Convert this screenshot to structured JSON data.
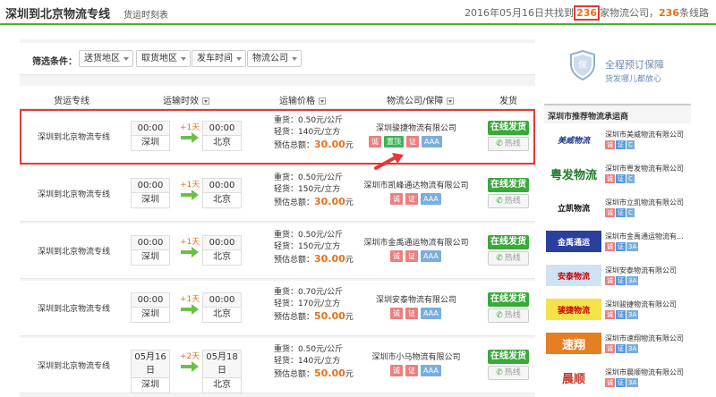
{
  "header": {
    "title": "深圳到北京物流专线",
    "subtitle": "货运时刻表",
    "stats_prefix": "2016年05月16日共找到",
    "company_count": "236",
    "stats_mid": "家物流公司，",
    "line_count": "236",
    "stats_suffix": "条线路"
  },
  "filter": {
    "label": "筛选条件：",
    "dropdowns": [
      "送货地区",
      "取货地区",
      "发车时间",
      "物流公司"
    ]
  },
  "table_headers": [
    "货运专线",
    "运输时效",
    "运输价格",
    "物流公司/保障",
    "发货"
  ],
  "rows": [
    {
      "route": "深圳到北京物流专线",
      "dep_time": "00:00",
      "dep_city": "深圳",
      "days": "+1天",
      "arr_time": "00:00",
      "arr_city": "北京",
      "heavy": "重货：0.50元/公斤",
      "light": "轻货：140元/立方",
      "total_label": "预估总额：",
      "total": "30.00",
      "total_unit": "元",
      "company": "深圳骏捷物流有限公司",
      "badges": [
        "诚",
        "置顶",
        "证",
        "AAA"
      ],
      "ship": "在线发货",
      "hotline": "热线"
    },
    {
      "route": "深圳到北京物流专线",
      "dep_time": "00:00",
      "dep_city": "深圳",
      "days": "+1天",
      "arr_time": "00:00",
      "arr_city": "北京",
      "heavy": "重货：0.50元/公斤",
      "light": "轻货：150元/立方",
      "total_label": "预估总额：",
      "total": "30.00",
      "total_unit": "元",
      "company": "深圳市凯峰通达物流有限公司",
      "badges": [
        "诚",
        "证",
        "AAA"
      ],
      "ship": "在线发货",
      "hotline": "热线"
    },
    {
      "route": "深圳到北京物流专线",
      "dep_time": "00:00",
      "dep_city": "深圳",
      "days": "+1天",
      "arr_time": "00:00",
      "arr_city": "北京",
      "heavy": "重货：0.50元/公斤",
      "light": "轻货：150元/立方",
      "total_label": "预估总额：",
      "total": "30.00",
      "total_unit": "元",
      "company": "深圳市金禹通运物流有限公司",
      "badges": [
        "诚",
        "证",
        "AAA"
      ],
      "ship": "在线发货",
      "hotline": "热线"
    },
    {
      "route": "深圳到北京物流专线",
      "dep_time": "00:00",
      "dep_city": "深圳",
      "days": "+1天",
      "arr_time": "00:00",
      "arr_city": "北京",
      "heavy": "重货：0.70元/公斤",
      "light": "轻货：170元/立方",
      "total_label": "预估总额：",
      "total": "50.00",
      "total_unit": "元",
      "company": "深圳安泰物流有限公司",
      "badges": [
        "诚",
        "证",
        "AAA"
      ],
      "ship": "在线发货",
      "hotline": "热线"
    },
    {
      "route": "深圳到北京物流专线",
      "dep_time": "05月16日",
      "dep_city": "深圳",
      "days": "+2天",
      "arr_time": "05月18日",
      "arr_city": "北京",
      "heavy": "重货：0.50元/公斤",
      "light": "轻货：140元/立方",
      "total_label": "预估总额：",
      "total": "50.00",
      "total_unit": "元",
      "company": "深圳市小马物流有限公司",
      "badges": [
        "诚",
        "证",
        "AAA"
      ],
      "ship": "在线发货",
      "hotline": "热线"
    }
  ],
  "sidebar": {
    "guarantee_title": "全程预订保障",
    "guarantee_sub": "货发哪儿都放心",
    "rec_title": "深圳市推荐物流承运商",
    "companies": [
      {
        "logo": "美威物流",
        "name": "深圳市美威物流有限公司",
        "badges": [
          "诚",
          "证",
          "C"
        ]
      },
      {
        "logo": "粤发物流",
        "name": "深圳市粤发物流有限公司",
        "badges": [
          "诚",
          "证",
          "C"
        ]
      },
      {
        "logo": "立凯物流",
        "name": "深圳市立凯物流有限公司",
        "badges": [
          "诚",
          "证",
          "C"
        ]
      },
      {
        "logo": "金禹通运",
        "name": "深圳市金禹通运物流有...",
        "badges": [
          "诚",
          "证",
          "3A"
        ]
      },
      {
        "logo": "安泰物流",
        "name": "深圳安泰物流有限公司",
        "badges": [
          "诚",
          "证",
          "3A"
        ]
      },
      {
        "logo": "骏捷物流",
        "name": "深圳骏捷物流有限公司",
        "badges": [
          "诚",
          "证",
          "3A"
        ]
      },
      {
        "logo": "速翔",
        "name": "深圳市速翔物流有限公司",
        "badges": [
          "诚",
          "证",
          "3A"
        ]
      },
      {
        "logo": "晨顺",
        "name": "深圳市晨顺物流有限公司",
        "badges": [
          "诚",
          "证",
          "3A"
        ]
      }
    ]
  },
  "colors": {
    "accent_green": "#3aa93a",
    "price_orange": "#e8701a",
    "highlight_red": "#e53935"
  }
}
